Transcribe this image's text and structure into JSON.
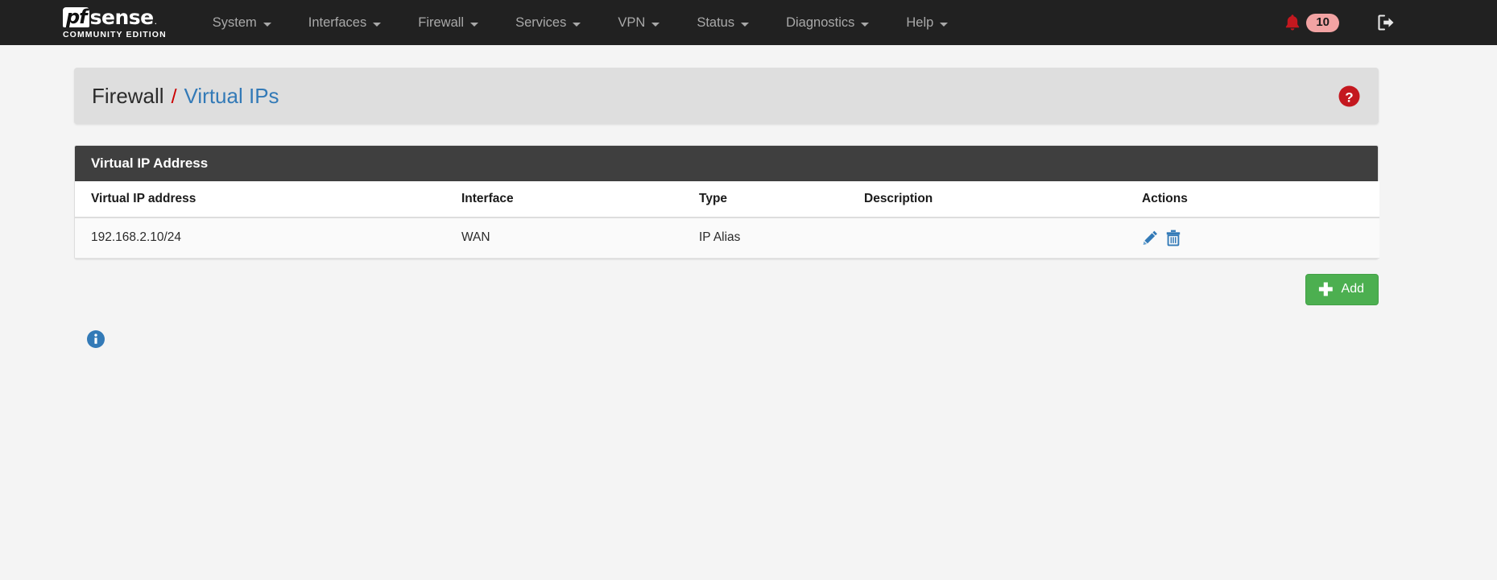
{
  "navbar": {
    "brand": {
      "pf": "pf",
      "sense": "sense",
      "subtitle": "COMMUNITY EDITION"
    },
    "menu": [
      {
        "label": "System",
        "icon": "chevron-down-icon"
      },
      {
        "label": "Interfaces",
        "icon": "chevron-down-icon"
      },
      {
        "label": "Firewall",
        "icon": "chevron-down-icon"
      },
      {
        "label": "Services",
        "icon": "chevron-down-icon"
      },
      {
        "label": "VPN",
        "icon": "chevron-down-icon"
      },
      {
        "label": "Status",
        "icon": "chevron-down-icon"
      },
      {
        "label": "Diagnostics",
        "icon": "chevron-down-icon"
      },
      {
        "label": "Help",
        "icon": "chevron-down-icon"
      }
    ],
    "notifications": {
      "icon": "bell-icon",
      "count": "10",
      "bell_color": "#c4181f",
      "badge_color": "#f2a3a3"
    },
    "logout": {
      "icon": "sign-out-icon"
    },
    "background_color": "#212121",
    "text_color": "#a9a9a9"
  },
  "breadcrumb": {
    "parent": "Firewall",
    "separator": "/",
    "current": "Virtual IPs",
    "separator_color": "#cc0000",
    "current_color": "#337ab7",
    "help": {
      "icon": "question-mark-icon",
      "color": "#c4181f"
    }
  },
  "panel": {
    "title": "Virtual IP Address",
    "header_background": "#3f3f3f",
    "columns": [
      "Virtual IP address",
      "Interface",
      "Type",
      "Description",
      "Actions"
    ],
    "rows": [
      {
        "virtual_ip": "192.168.2.10/24",
        "interface": "WAN",
        "type": "IP Alias",
        "description": "",
        "actions": [
          {
            "name": "edit",
            "icon": "pencil-icon",
            "color": "#337ab7"
          },
          {
            "name": "delete",
            "icon": "trash-icon",
            "color": "#337ab7"
          }
        ]
      }
    ]
  },
  "add_button": {
    "label": "Add",
    "icon": "plus-icon",
    "color": "#4caf50"
  },
  "info": {
    "icon": "info-circle-icon",
    "color": "#337ab7"
  }
}
